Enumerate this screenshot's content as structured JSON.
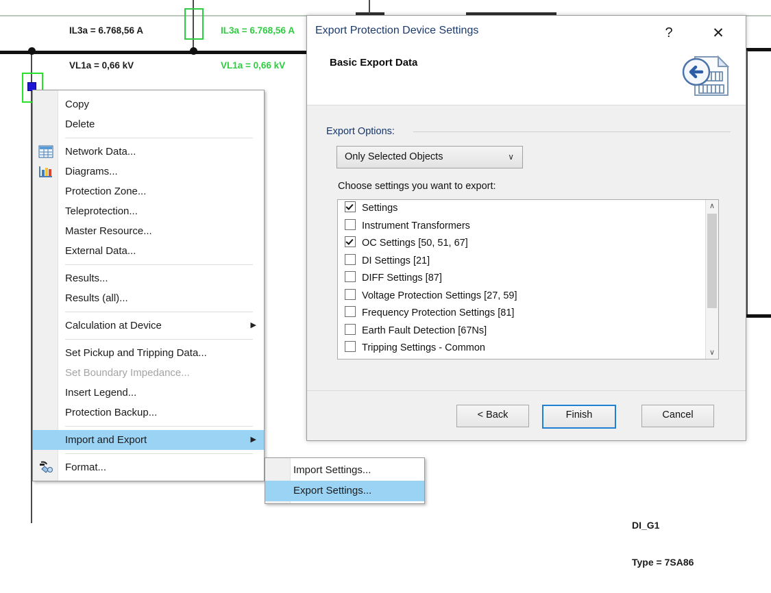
{
  "diagram": {
    "labels": [
      {
        "id": "meas-black",
        "line1": "IL3a = 6.768,56 A",
        "line2": "VL1a = 0,66 kV",
        "color": "#1b1b1b"
      },
      {
        "id": "meas-green",
        "line1": "IL3a = 6.768,56 A",
        "line2": "VL1a = 0,66 kV",
        "color": "#2ecc40"
      },
      {
        "id": "device",
        "line1": "DI_G1",
        "line2": "Type = 7SA86",
        "color": "#1b1b1b"
      }
    ],
    "selection_color": "#27e327",
    "handle_color": "#1f15d6",
    "busbar_color": "#111111"
  },
  "context_menu": {
    "items": [
      {
        "label": "Copy",
        "icon": "",
        "type": "item"
      },
      {
        "label": "Delete",
        "icon": "",
        "type": "item"
      },
      {
        "type": "separator"
      },
      {
        "label": "Network Data...",
        "icon": "table-icon",
        "type": "item"
      },
      {
        "label": "Diagrams...",
        "icon": "bar-chart-icon",
        "type": "item"
      },
      {
        "label": "Protection Zone...",
        "icon": "",
        "type": "item"
      },
      {
        "label": "Teleprotection...",
        "icon": "",
        "type": "item"
      },
      {
        "label": "Master Resource...",
        "icon": "",
        "type": "item"
      },
      {
        "label": "External Data...",
        "icon": "",
        "type": "item"
      },
      {
        "type": "separator"
      },
      {
        "label": "Results...",
        "icon": "",
        "type": "item"
      },
      {
        "label": "Results (all)...",
        "icon": "",
        "type": "item"
      },
      {
        "type": "separator"
      },
      {
        "label": "Calculation at Device",
        "icon": "",
        "type": "submenu"
      },
      {
        "type": "separator"
      },
      {
        "label": "Set Pickup and Tripping Data...",
        "icon": "",
        "type": "item"
      },
      {
        "label": "Set Boundary Impedance...",
        "icon": "",
        "type": "disabled"
      },
      {
        "label": "Insert Legend...",
        "icon": "",
        "type": "item"
      },
      {
        "label": "Protection Backup...",
        "icon": "",
        "type": "item"
      },
      {
        "type": "separator"
      },
      {
        "label": "Import and Export",
        "icon": "",
        "type": "submenu-highlighted"
      },
      {
        "type": "separator"
      },
      {
        "label": "Format...",
        "icon": "format-painter-icon",
        "type": "item"
      }
    ],
    "submenu": {
      "items": [
        {
          "label": "Import Settings...",
          "highlighted": false
        },
        {
          "label": "Export Settings...",
          "highlighted": true
        }
      ]
    },
    "highlight_color": "#9bd3f5",
    "submenu_arrow": "▶"
  },
  "dialog": {
    "title": "Export Protection Device Settings",
    "subtitle": "Basic Export Data",
    "help_glyph": "?",
    "close_glyph": "✕",
    "export_options_label": "Export Options:",
    "combo": {
      "value": "Only Selected Objects",
      "chevron": "∨"
    },
    "choose_label": "Choose settings you want to export:",
    "settings_list": [
      {
        "label": "Settings",
        "checked": true
      },
      {
        "label": "Instrument Transformers",
        "checked": false
      },
      {
        "label": "OC Settings [50, 51, 67]",
        "checked": true
      },
      {
        "label": "DI Settings [21]",
        "checked": false
      },
      {
        "label": "DIFF Settings [87]",
        "checked": false
      },
      {
        "label": "Voltage Protection Settings [27, 59]",
        "checked": false
      },
      {
        "label": "Frequency Protection Settings [81]",
        "checked": false
      },
      {
        "label": "Earth Fault Detection [67Ns]",
        "checked": false
      },
      {
        "label": "Tripping Settings - Common",
        "checked": false
      }
    ],
    "scrollbar": {
      "up_glyph": "∧",
      "down_glyph": "∨"
    },
    "buttons": {
      "back": "< Back",
      "finish": "Finish",
      "cancel": "Cancel"
    },
    "focus_color": "#1f7fd4"
  }
}
